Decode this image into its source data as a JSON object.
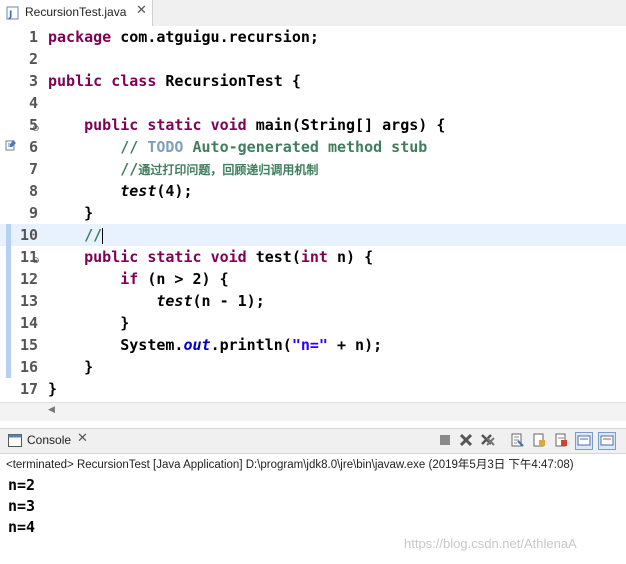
{
  "editor_tab": {
    "title": "RecursionTest.java",
    "close": "✕"
  },
  "code_lines": [
    {
      "num": "1",
      "segments": [
        [
          "kw",
          "package"
        ],
        [
          "",
          " com.atguigu.recursion;"
        ]
      ]
    },
    {
      "num": "2",
      "segments": []
    },
    {
      "num": "3",
      "segments": [
        [
          "kw",
          "public"
        ],
        [
          "",
          " "
        ],
        [
          "kw",
          "class"
        ],
        [
          "",
          " RecursionTest {"
        ]
      ]
    },
    {
      "num": "4",
      "segments": []
    },
    {
      "num": "5",
      "segments": [
        [
          "",
          "    "
        ],
        [
          "kw",
          "public"
        ],
        [
          "",
          " "
        ],
        [
          "kw",
          "static"
        ],
        [
          "",
          " "
        ],
        [
          "kw",
          "void"
        ],
        [
          "",
          " main(String[] args) {"
        ]
      ]
    },
    {
      "num": "6",
      "segments": [
        [
          "",
          "        "
        ],
        [
          "cm",
          "// "
        ],
        [
          "todo",
          "TODO"
        ],
        [
          "cm",
          " Auto-generated method stub"
        ]
      ]
    },
    {
      "num": "7",
      "segments": [
        [
          "",
          "        "
        ],
        [
          "cm",
          "//"
        ],
        [
          "cm cjk",
          "通过打印问题，回顾递归调用机制"
        ]
      ]
    },
    {
      "num": "8",
      "segments": [
        [
          "",
          "        "
        ],
        [
          "it",
          "test"
        ],
        [
          "",
          "(4);"
        ]
      ]
    },
    {
      "num": "9",
      "segments": [
        [
          "",
          "    }"
        ]
      ]
    },
    {
      "num": "10",
      "segments": [
        [
          "",
          "    "
        ],
        [
          "cm",
          "//"
        ]
      ]
    },
    {
      "num": "11",
      "segments": [
        [
          "",
          "    "
        ],
        [
          "kw",
          "public"
        ],
        [
          "",
          " "
        ],
        [
          "kw",
          "static"
        ],
        [
          "",
          " "
        ],
        [
          "kw",
          "void"
        ],
        [
          "",
          " test("
        ],
        [
          "kw",
          "int"
        ],
        [
          "",
          " n) {"
        ]
      ]
    },
    {
      "num": "12",
      "segments": [
        [
          "",
          "        "
        ],
        [
          "kw",
          "if"
        ],
        [
          "",
          " (n > 2) {"
        ]
      ]
    },
    {
      "num": "13",
      "segments": [
        [
          "",
          "            "
        ],
        [
          "it",
          "test"
        ],
        [
          "",
          "(n - 1);"
        ]
      ]
    },
    {
      "num": "14",
      "segments": [
        [
          "",
          "        }"
        ]
      ]
    },
    {
      "num": "15",
      "segments": [
        [
          "",
          "        System."
        ],
        [
          "fld",
          "out"
        ],
        [
          "",
          ".println("
        ],
        [
          "str",
          "\"n=\""
        ],
        [
          "",
          " + n);"
        ]
      ]
    },
    {
      "num": "16",
      "segments": [
        [
          "",
          "    }"
        ]
      ]
    },
    {
      "num": "17",
      "segments": [
        [
          "",
          "}"
        ]
      ]
    }
  ],
  "current_line": 10,
  "console": {
    "tab_label": "Console",
    "close": "✕",
    "status": "<terminated> RecursionTest [Java Application] D:\\program\\jdk8.0\\jre\\bin\\javaw.exe (2019年5月3日 下午4:47:08)",
    "output": [
      "n=2",
      "n=3",
      "n=4"
    ]
  },
  "watermark": "https://blog.csdn.net/AthlenaA",
  "colors": {
    "keyword": "#7f0055",
    "comment": "#3f7f5f",
    "todo": "#7f9fbf",
    "string": "#2a00ff",
    "field": "#0000c0",
    "current_line": "#e8f2fe"
  }
}
